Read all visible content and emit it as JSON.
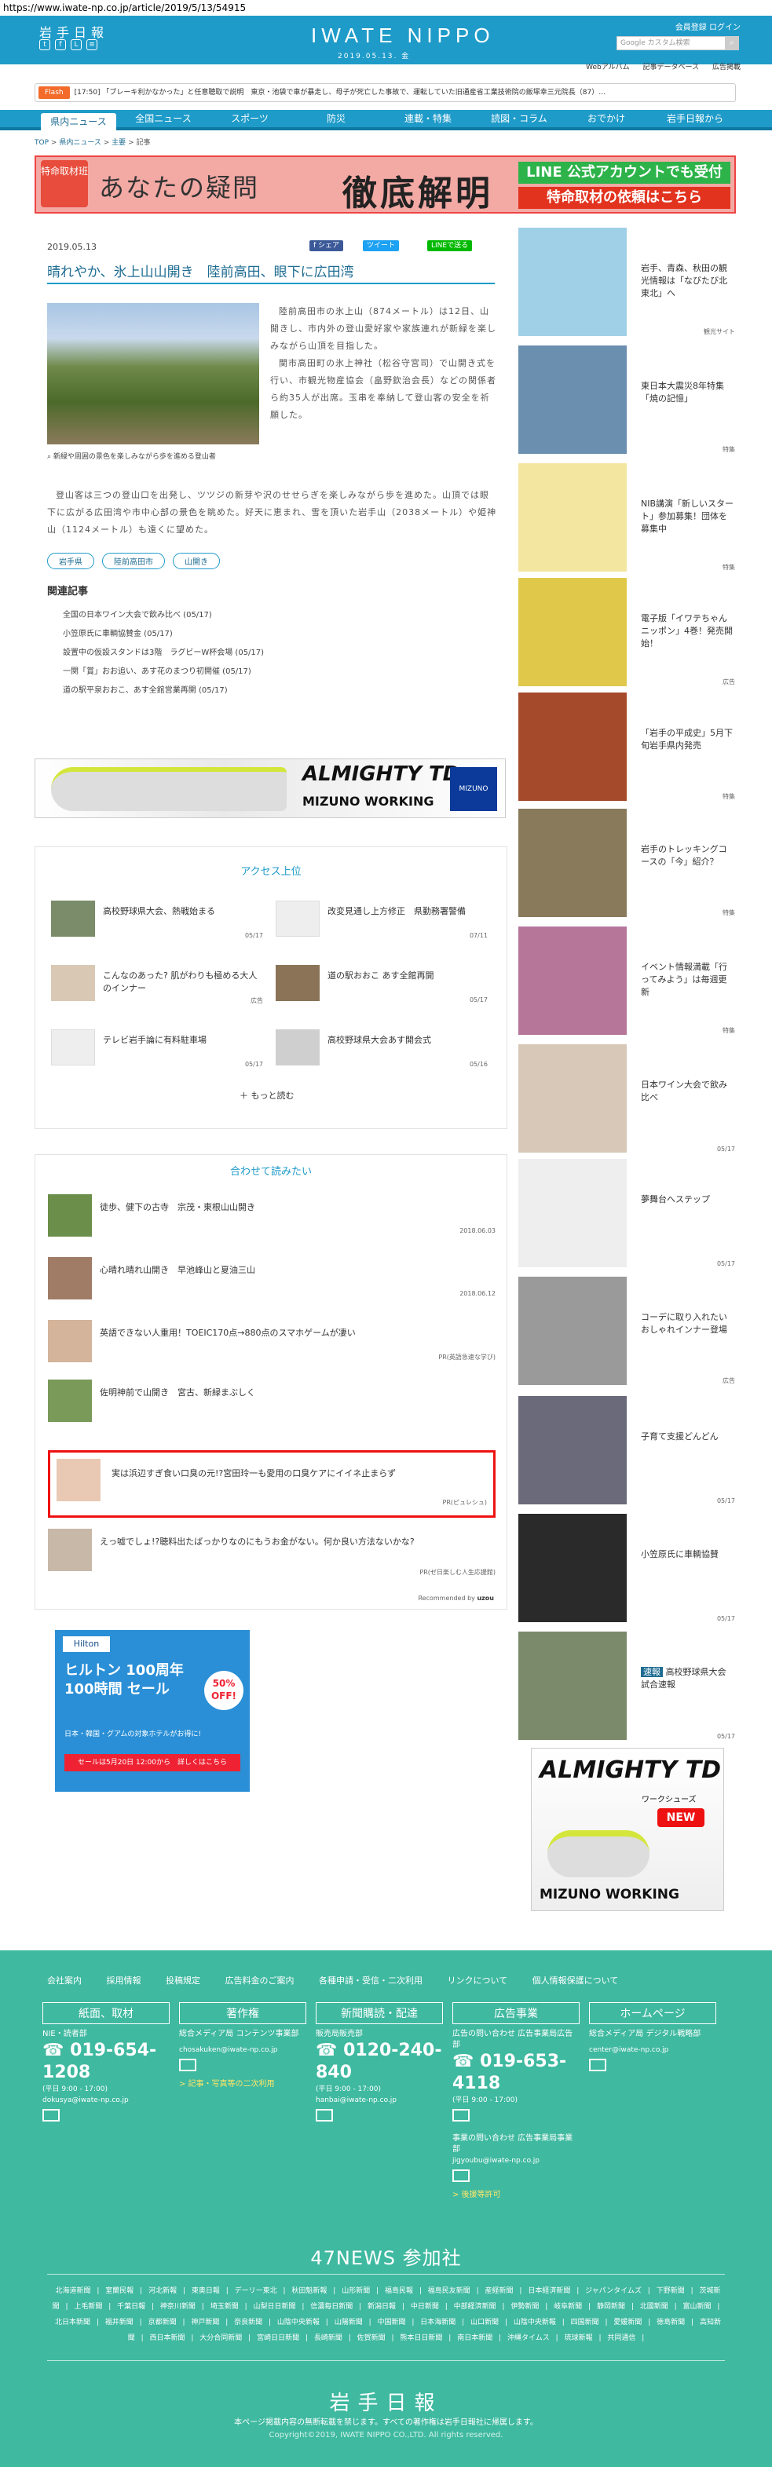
{
  "url": "https://www.iwate-np.co.jp/article/2019/5/13/54915",
  "header": {
    "logo_ja": "岩手日報",
    "logo_en": "IWATE NIPPO",
    "date": "2019.05.13. 金",
    "links": "会員登録  ログイン",
    "search_placeholder": "Google カスタム検索",
    "subnav": [
      "Webアルバム",
      "記事データベース",
      "広告掲載"
    ]
  },
  "flash": {
    "tag": "Flash",
    "text": "[17:50] 「ブレーキ利かなかった」と任意聴取で説明　東京・池袋で車が暴走し、母子が死亡した事故で、運転していた旧通産省工業技術院の飯塚幸三元院長（87）…"
  },
  "gnav": [
    "県内ニュース",
    "全国ニュース",
    "スポーツ",
    "防災",
    "連載・特集",
    "読図・コラム",
    "おでかけ",
    "岩手日報から"
  ],
  "breadcrumb": {
    "top": "TOP",
    "sep": ">",
    "cat": "県内ニュース",
    "sub": "主要",
    "cur": "記事"
  },
  "banner": {
    "badge": "特命取材班",
    "text1": "あなたの疑問",
    "text2": "徹底解明",
    "line1": "LINE 公式アカウントでも受付",
    "line2": "特命取材の依頼はこちら"
  },
  "article": {
    "date": "2019.05.13",
    "share": [
      "f シェア",
      "ツイート",
      "LINEで送る"
    ],
    "title": "晴れやか、氷上山山開き　陸前高田、眼下に広田湾",
    "caption": "新緑や周囲の景色を楽しみながら歩を進める登山者",
    "body1": "陸前高田市の氷上山（874メートル）は12日、山開きし、市内外の登山愛好家や家族連れが新緑を楽しみながら山頂を目指した。",
    "body2": "関市高田町の氷上神社（松谷守宮司）で山開き式を行い、市観光物産協会（畠野欽治会長）などの関係者ら約35人が出席。玉串を奉納して登山客の安全を祈願した。",
    "body3": "登山客は三つの登山口を出発し、ツツジの新芽や沢のせせらぎを楽しみながら歩を進めた。山頂では眼下に広がる広田湾や市中心部の景色を眺めた。好天に恵まれ、雪を頂いた岩手山（2038メートル）や姫神山（1124メートル）も遠くに望めた。",
    "tags": [
      "岩手県",
      "陸前高田市",
      "山開き"
    ],
    "related_heading": "関連記事",
    "related": [
      "全国の日本ワイン大会で飲み比べ (05/17)",
      "小笠原氏に車輌協賛金 (05/17)",
      "設置中の仮設スタンドは3階　ラグビーW杯会場 (05/17)",
      "一関「賞」おお追い、あす花のまつり初開催 (05/17)",
      "道の駅平泉おおこ、あす全館営業再開 (05/17)"
    ]
  },
  "ad_shoe": {
    "brand": "ALMIGHTY TD",
    "sub": "MIZUNO WORKING",
    "logo": "MIZUNO"
  },
  "ranking": {
    "title": "アクセス上位",
    "items": [
      {
        "text": "高校野球県大会、熱戦始まる",
        "date": "05/17"
      },
      {
        "text": "改変見通し上方修正　県勤務署警備",
        "date": "07/11"
      },
      {
        "text": "こんなのあった? 肌がわりも極める大人のインナー",
        "date": "広告"
      },
      {
        "text": "道の駅おおこ あす全館再開",
        "date": "05/17"
      },
      {
        "text": "テレビ岩手論に有料駐車場",
        "date": "05/17"
      },
      {
        "text": "高校野球県大会あす開会式",
        "date": "05/16"
      }
    ],
    "more": "もっと読む"
  },
  "also": {
    "title": "合わせて読みたい",
    "items": [
      {
        "text": "徒歩、健下の古寺　宗茂・東根山山開き",
        "date": "2018.06.03"
      },
      {
        "text": "心晴れ晴れ山開き　早池峰山と夏油三山",
        "date": "2018.06.12"
      },
      {
        "text": "英語できない人重用！TOEIC170点→880点のスマホゲームが凄い",
        "date": "PR(英語急速な学び)"
      },
      {
        "text": "佐明神前で山開き　宮古、新緑まぶしく",
        "date": ""
      },
      {
        "text": "実は浜辺すぎ食い口臭の元!?宮田玲一も愛用の口臭ケアにイイネ止まらず",
        "date": "PR(ピュレシュ)"
      },
      {
        "text": "えっ嘘でしょ!?聴料出たばっかりなのにもうお金がない。何か良い方法ないかな?",
        "date": "PR(ゼ日楽しむ人生応援館)"
      }
    ],
    "powered": "Recommended by"
  },
  "hilton_ad": {
    "brand": "Hilton",
    "headline": "ヒルトン 100周年 100時間 セール",
    "off": "50% OFF!",
    "sub": "日本・韓国・グアムの対象ホテルがお得に!",
    "cta": "セールは5月20日 12:00から　詳しくはこちら"
  },
  "sidebar": [
    {
      "text": "岩手、青森、秋田の観光情報は「なびたび北東北」へ",
      "date": "観光サイト"
    },
    {
      "text": "東日本大震災8年特集「焼の記憶」",
      "date": "特集"
    },
    {
      "text": "NIB講演「新しいスタート」参加募集！団体を募集中",
      "date": "特集"
    },
    {
      "text": "電子版「イワテちゃんニッポン」4巻！発売開始！",
      "date": "広告"
    },
    {
      "text": "「岩手の平成史」5月下旬岩手県内発売",
      "date": "特集"
    },
    {
      "text": "岩手のトレッキングコースの「今」紹介？",
      "date": "特集"
    },
    {
      "text": "イベント情報満載「行ってみよう」は毎週更新",
      "date": "特集"
    },
    {
      "text": "日本ワイン大会で飲み比べ",
      "date": "05/17"
    },
    {
      "text": "夢舞台へステップ",
      "date": "05/17"
    },
    {
      "text": "コーデに取り入れたいおしゃれインナー登場",
      "date": "広告"
    },
    {
      "text": "子育て支援どんどん",
      "date": "05/17"
    },
    {
      "text": "小笠原氏に車輌協賛",
      "date": "05/17"
    },
    {
      "text": "高校野球県大会　試合速報",
      "date": "05/17"
    }
  ],
  "sidebar_tag": "速報",
  "side_ad": {
    "brand": "ALMIGHTY TD",
    "label": "ワークシューズ",
    "new": "NEW",
    "bottom": "MIZUNO WORKING"
  },
  "footer": {
    "links": [
      "会社案内",
      "採用情報",
      "投稿規定",
      "広告料金のご案内",
      "各種申請・受信・二次利用",
      "リンクについて",
      "個人情報保護について"
    ],
    "cols": [
      {
        "head": "紙面、取材",
        "l1": "NIE・読者部",
        "phone": "019-654-1208",
        "hours": "(平日 9:00 - 17:00)",
        "mail": "dokusya@iwate-np.co.jp",
        "extra": ""
      },
      {
        "head": "著作権",
        "l1": "総合メディア局 コンテンツ事業部",
        "phone": "",
        "hours": "",
        "mail": "chosakuken@iwate-np.co.jp",
        "extra": "> 記事・写真等の二次利用"
      },
      {
        "head": "新聞購読・配達",
        "l1": "販売局販売部",
        "phone": "0120-240-840",
        "hours": "(平日 9:00 - 17:00)",
        "mail": "hanbai@iwate-np.co.jp",
        "extra": ""
      },
      {
        "head": "広告事業",
        "l1": "広告の問い合わせ 広告事業局広告部",
        "phone": "019-653-4118",
        "hours": "(平日 9:00 - 17:00)",
        "mail": "jigyoubu@iwate-np.co.jp",
        "extra": "> 後援等許可"
      },
      {
        "head": "ホームページ",
        "l1": "総合メディア局 デジタル戦略部",
        "phone": "",
        "hours": "",
        "mail": "center@iwate-np.co.jp",
        "extra": ""
      }
    ],
    "col4_extra": "事業の問い合わせ 広告事業局事業部",
    "n47": "47NEWS 参加社",
    "papers": [
      "北海道新聞",
      "室蘭民報",
      "河北新報",
      "東奥日報",
      "デーリー東北",
      "秋田魁新報",
      "山形新聞",
      "福島民報",
      "福島民友新聞",
      "産経新聞",
      "日本経済新聞",
      "ジャパンタイムズ",
      "下野新聞",
      "茨城新聞",
      "上毛新聞",
      "千葉日報",
      "神奈川新聞",
      "埼玉新聞",
      "山梨日日新聞",
      "信濃毎日新聞",
      "新潟日報",
      "中日新聞",
      "中部経済新聞",
      "伊勢新聞",
      "岐阜新聞",
      "静岡新聞",
      "北國新聞",
      "富山新聞",
      "北日本新聞",
      "福井新聞",
      "京都新聞",
      "神戸新聞",
      "奈良新聞",
      "山陰中央新報",
      "山陽新聞",
      "中国新聞",
      "日本海新聞",
      "山口新聞",
      "山陰中央新報",
      "四国新聞",
      "愛媛新聞",
      "徳島新聞",
      "高知新聞",
      "西日本新聞",
      "大分合同新聞",
      "宮崎日日新聞",
      "長崎新聞",
      "佐賀新聞",
      "熊本日日新聞",
      "南日本新聞",
      "沖縄タイムス",
      "琉球新報",
      "共同通信"
    ],
    "logo": "岩手日報",
    "copy1": "本ページ掲載内容の無断転載を禁じます。すべての著作権は岩手日報社に帰属します。",
    "copy2": "Copyright©2019, IWATE NIPPO CO.,LTD. All rights reserved."
  },
  "colors": {
    "brand": "#1e9bc9",
    "footer": "#3fb9a0",
    "flash": "#f36a2a",
    "highlight": "#e11111"
  }
}
